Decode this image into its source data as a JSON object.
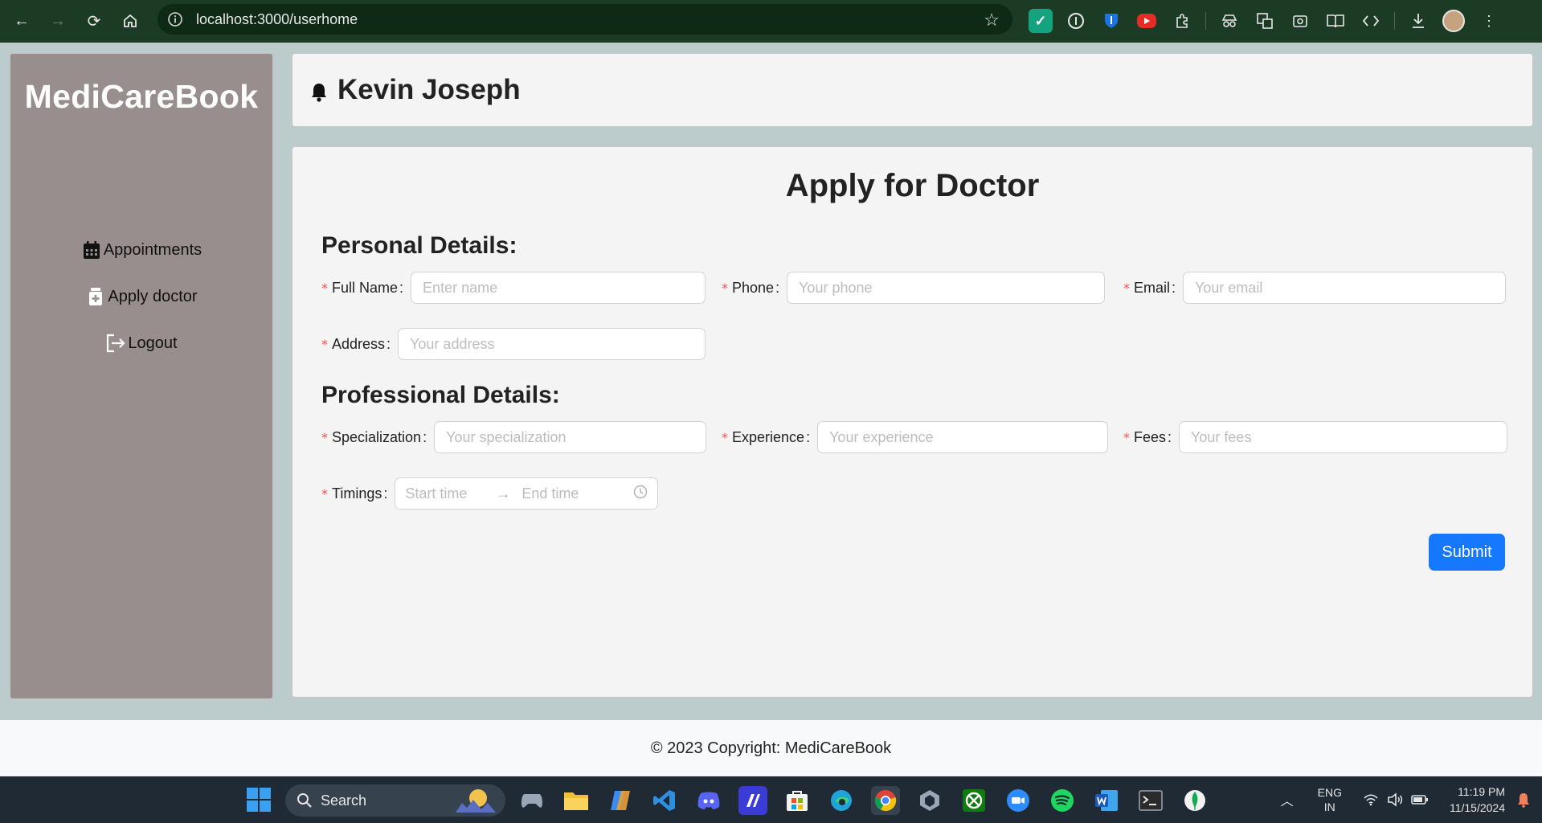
{
  "browser": {
    "url": "localhost:3000/userhome",
    "extensions": [
      "grammarly-icon",
      "onepassword-icon",
      "bitwarden-icon",
      "youtube-icon",
      "extensions-icon",
      "incognito-icon",
      "translate-icon",
      "screenshot-icon",
      "reading-mode-icon",
      "devtools-icon",
      "download-icon"
    ]
  },
  "sidebar": {
    "brand": "MediCareBook",
    "items": [
      {
        "label": "Appointments",
        "icon": "calendar-icon"
      },
      {
        "label": "Apply doctor",
        "icon": "medical-doc-icon"
      },
      {
        "label": "Logout",
        "icon": "logout-icon"
      }
    ]
  },
  "header": {
    "user_name": "Kevin Joseph"
  },
  "form": {
    "title": "Apply for Doctor",
    "personal_title": "Personal Details:",
    "professional_title": "Professional Details:",
    "full_name": {
      "label": "Full Name",
      "placeholder": "Enter name"
    },
    "phone": {
      "label": "Phone",
      "placeholder": "Your phone"
    },
    "email": {
      "label": "Email",
      "placeholder": "Your email"
    },
    "address": {
      "label": "Address",
      "placeholder": "Your address"
    },
    "specialization": {
      "label": "Specialization",
      "placeholder": "Your specialization"
    },
    "experience": {
      "label": "Experience",
      "placeholder": "Your experience"
    },
    "fees": {
      "label": "Fees",
      "placeholder": "Your fees"
    },
    "timings": {
      "label": "Timings",
      "start_placeholder": "Start time",
      "end_placeholder": "End time"
    },
    "submit_label": "Submit",
    "colors": {
      "primary": "#1677ff",
      "required": "#ff4d4f"
    }
  },
  "footer": {
    "text": "© 2023 Copyright: MediCareBook"
  },
  "taskbar": {
    "search_label": "Search",
    "lang_line1": "ENG",
    "lang_line2": "IN",
    "time": "11:19 PM",
    "date": "11/15/2024"
  }
}
